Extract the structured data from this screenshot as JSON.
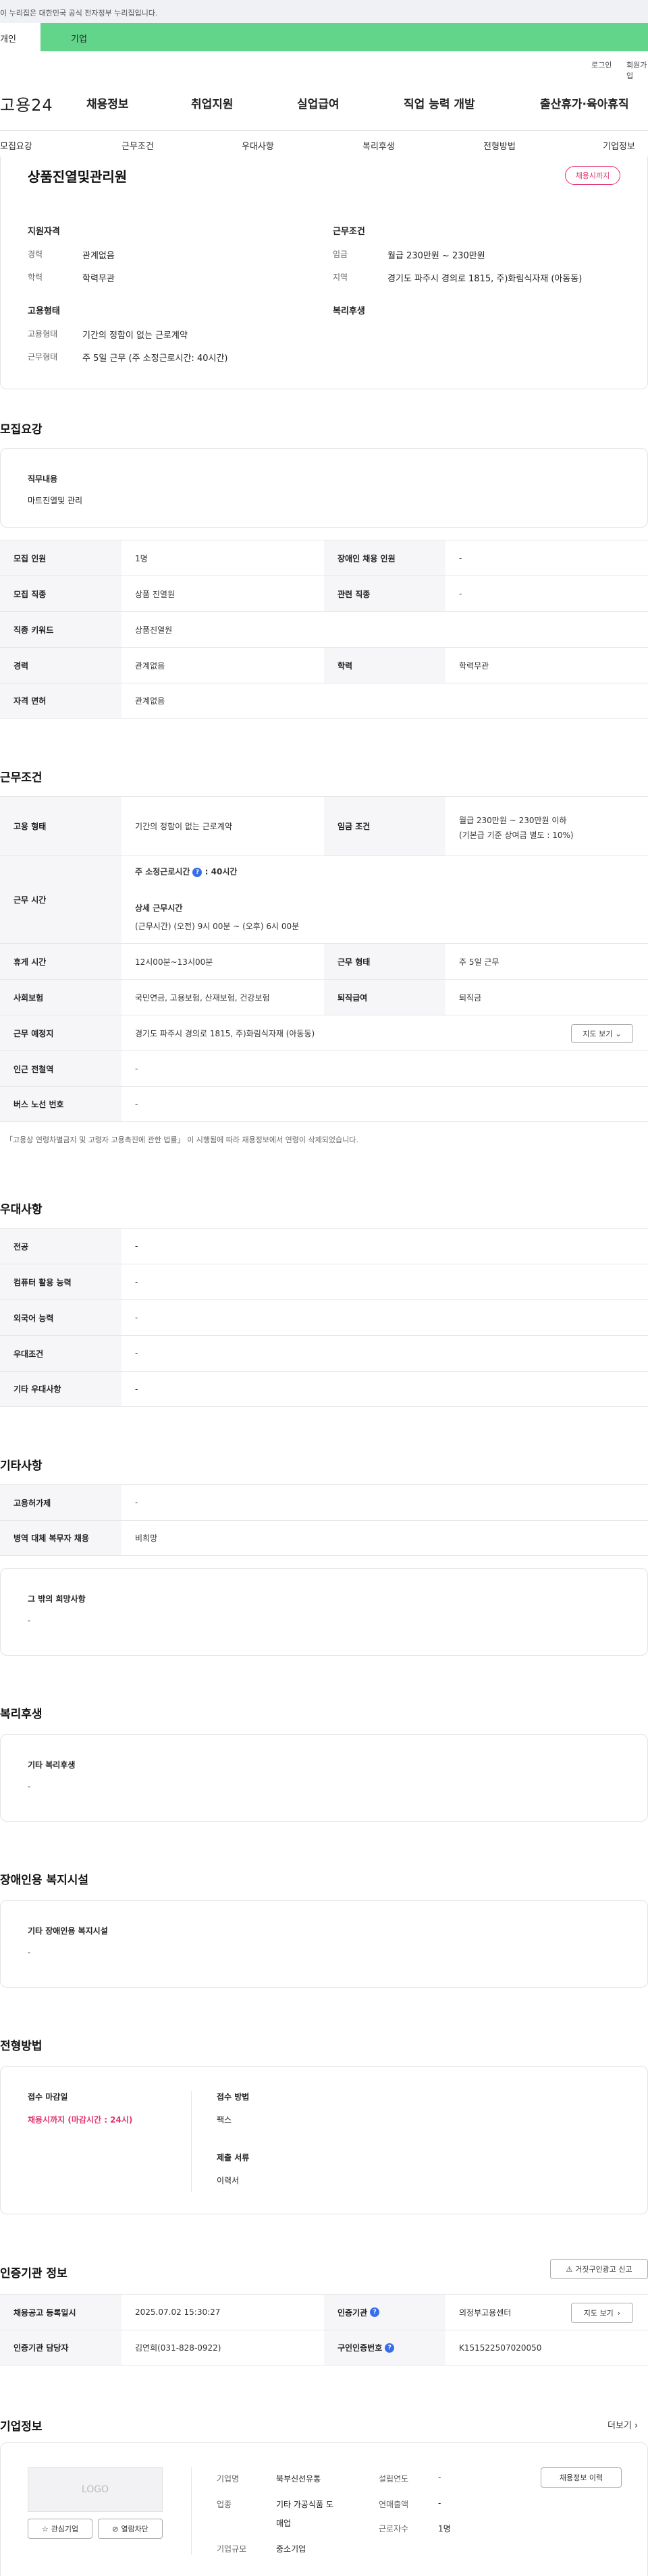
{
  "gov_banner": "이 누리집은 대한민국 공식 전자정부 누리집입니다.",
  "user_tabs": [
    "개인",
    "기업"
  ],
  "util_links": [
    "로그인",
    "회원가입"
  ],
  "logo": "고용24",
  "gnb": [
    "채용정보",
    "취업지원",
    "실업급여",
    "직업 능력 개발",
    "출산휴가·육아휴직"
  ],
  "snb": [
    "모집요강",
    "근무조건",
    "우대사항",
    "복리후생",
    "전형방법",
    "기업정보"
  ],
  "summary": {
    "title": "상품진열및관리원",
    "badge": "채용시까지",
    "qual_title": "지원자격",
    "work_title": "근무조건",
    "career_k": "경력",
    "career_v": "관계없음",
    "edu_k": "학력",
    "edu_v": "학력무관",
    "wage_k": "임금",
    "wage_v": "월급 230만원 ~ 230만원",
    "area_k": "지역",
    "area_v": "경기도 파주시 경의로 1815, 주)화림식자재 (아동동)",
    "emp_title": "고용형태",
    "welfare_title": "복리후생",
    "emptype_k": "고용형태",
    "emptype_v": "기간의 정함이 없는 근로계약",
    "worktype_k": "근무형태",
    "worktype_v": "주 5일 근무 (주 소정근로시간: 40시간)"
  },
  "recruit": {
    "title": "모집요강",
    "duty_label": "직무내용",
    "duty_value": "마트진열및 관리",
    "rows": [
      {
        "k1": "모집 인원",
        "v1": "1명",
        "k2": "장애인 채용 인원",
        "v2": "-"
      },
      {
        "k1": "모집 직종",
        "v1": "상품 진열원",
        "k2": "관련 직종",
        "v2": "-"
      },
      {
        "k1": "직종 키워드",
        "v1": "상품진열원"
      },
      {
        "k1": "경력",
        "v1": "관계없음",
        "k2": "학력",
        "v2": "학력무관"
      },
      {
        "k1": "자격 면허",
        "v1": "관계없음"
      }
    ]
  },
  "work": {
    "title": "근무조건",
    "emptype_k": "고용 형태",
    "emptype_v": "기간의 정함이 없는 근로계약",
    "wage_k": "임금 조건",
    "wage_v1": "월급 230만원 ~ 230만원 이하",
    "wage_v2": "(기본급 기준 상여금 별도 : 10%)",
    "time_k": "근무 시간",
    "time_v1": "주 소정근로시간",
    "time_v1b": ": 40시간",
    "time_v2": "상세 근무시간",
    "time_v3": "(근무시간) (오전) 9시 00분 ~ (오후) 6시 00분",
    "rest_k": "휴게 시간",
    "rest_v": "12시00분~13시00분",
    "form_k": "근무 형태",
    "form_v": "주 5일 근무",
    "ins_k": "사회보험",
    "ins_v": "국민연금, 고용보험, 산재보험, 건강보험",
    "retire_k": "퇴직급여",
    "retire_v": "퇴직금",
    "place_k": "근무 예정지",
    "place_v": "경기도 파주시 경의로 1815, 주)화림식자재 (아동동)",
    "map_btn": "지도 보기",
    "subway_k": "인근 전철역",
    "subway_v": "-",
    "bus_k": "버스 노선 번호",
    "bus_v": "-",
    "note": "「고용상 연령차별금지 및 고령자 고용촉진에 관한 법률」 이 시행됨에 따라 채용정보에서 연령이 삭제되었습니다."
  },
  "pref": {
    "title": "우대사항",
    "rows": [
      {
        "k": "전공",
        "v": "-"
      },
      {
        "k": "컴퓨터 활용 능력",
        "v": "-"
      },
      {
        "k": "외국어 능력",
        "v": "-"
      },
      {
        "k": "우대조건",
        "v": "-"
      },
      {
        "k": "기타 우대사항",
        "v": "-"
      }
    ]
  },
  "etc": {
    "title": "기타사항",
    "rows": [
      {
        "k": "고용허가제",
        "v": "-"
      },
      {
        "k": "병역 대체 복무자 채용",
        "v": "비희망"
      }
    ],
    "box_label": "그 밖의 희망사항",
    "box_value": "-"
  },
  "welfare": {
    "title": "복리후생",
    "label": "기타 복리후생",
    "value": "-"
  },
  "disab": {
    "title": "장애인용 복지시설",
    "label": "기타 장애인용 복지시설",
    "value": "-"
  },
  "select": {
    "title": "전형방법",
    "deadline_k": "접수 마감일",
    "deadline_v": "채용시까지 (마감시간 : 24시)",
    "method_k": "접수 방법",
    "method_v": "팩스",
    "docs_k": "제출 서류",
    "docs_v": "이력서"
  },
  "agency": {
    "title": "인증기관 정보",
    "report_btn": "거짓구인광고 신고",
    "reg_k": "채용공고 등록일시",
    "reg_v": "2025.07.02 15:30:27",
    "org_k": "인증기관",
    "org_v": "의정부고용센터",
    "map_btn": "지도 보기",
    "mgr_k": "인증기관 담당자",
    "mgr_v": "김연희(031-828-0922)",
    "no_k": "구인인증번호",
    "no_v": "K151522507020050"
  },
  "company": {
    "title": "기업정보",
    "more": "더보기",
    "logo_text": "LOGO",
    "fav_btn": "관심기업",
    "block_btn": "열람차단",
    "name_k": "기업명",
    "name_v": "북부신선유통",
    "ind_k": "업종",
    "ind_v1": "기타 가공식품 도",
    "ind_v2": "매업",
    "size_k": "기업규모",
    "size_v": "중소기업",
    "est_k": "설립연도",
    "est_v": "-",
    "sales_k": "연매출액",
    "sales_v": "-",
    "emp_k": "근로자수",
    "emp_v": "1명",
    "history_btn": "채용정보 이력"
  }
}
